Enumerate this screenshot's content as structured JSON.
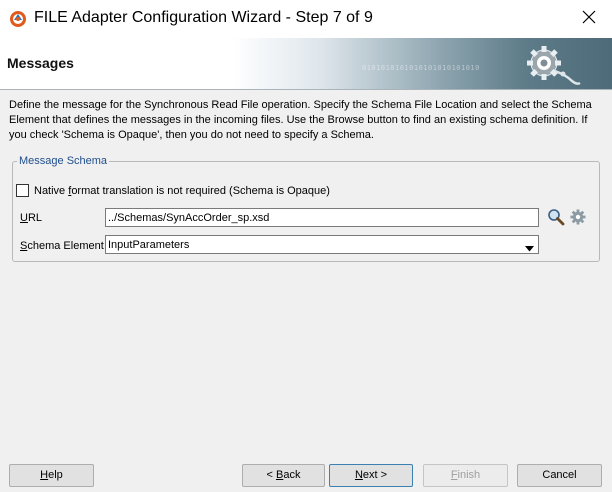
{
  "window": {
    "title": "FILE Adapter Configuration Wizard - Step 7 of 9",
    "app_icon": "oracle-jdeveloper-icon",
    "close_icon": "close-icon"
  },
  "header": {
    "title": "Messages",
    "binary_text": "0101010101010101010101010",
    "graphic_icon": "gear-icon"
  },
  "description": "Define the message for the Synchronous Read File operation.  Specify the Schema File Location and select the Schema Element that defines the messages in the incoming files. Use the Browse button to find an existing schema definition. If you check 'Schema is Opaque', then you do not need to specify a Schema.",
  "message_schema": {
    "legend": "Message Schema",
    "opaque_checkbox": {
      "checked": false,
      "label_pre": "Native ",
      "label_mn": "f",
      "label_post": "ormat translation is not required (Schema is Opaque)"
    },
    "url": {
      "label_mn": "U",
      "label_post": "RL",
      "value": "../Schemas/SynAccOrder_sp.xsd",
      "search_icon": "search-icon",
      "settings_icon": "gear-icon"
    },
    "schema_element": {
      "label_mn": "S",
      "label_post": "chema Element",
      "value": "InputParameters"
    }
  },
  "buttons": {
    "help": {
      "mn": "H",
      "post": "elp"
    },
    "back": {
      "pre": "< ",
      "mn": "B",
      "post": "ack"
    },
    "next": {
      "mn": "N",
      "post": "ext >"
    },
    "finish": {
      "mn": "F",
      "post": "inish"
    },
    "cancel": {
      "label": "Cancel"
    }
  },
  "colors": {
    "legend_text": "#1f4e8c",
    "next_border": "#3c7fb1",
    "banner_dark": "#4d6b78"
  }
}
